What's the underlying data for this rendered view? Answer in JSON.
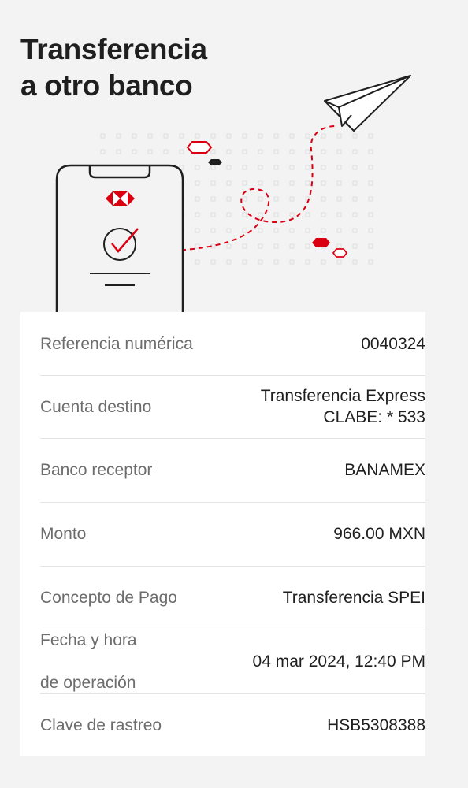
{
  "header": {
    "title_line1": "Transferencia",
    "title_line2": "a otro banco"
  },
  "colors": {
    "accent": "#db0011",
    "text": "#1f1f1f",
    "muted": "#6d6d6d",
    "background": "#f3f3f3"
  },
  "illustration": {
    "icons": [
      "phone-icon",
      "hsbc-logo-icon",
      "check-circle-icon",
      "paper-plane-icon",
      "hexagon-icon"
    ]
  },
  "details": {
    "rows": [
      {
        "label": "Referencia numérica",
        "value": "0040324"
      },
      {
        "label": "Cuenta destino",
        "value_line1": "Transferencia Express",
        "value_line2": "CLABE: * 533"
      },
      {
        "label": "Banco receptor",
        "value": "BANAMEX"
      },
      {
        "label": "Monto",
        "value": "966.00 MXN"
      },
      {
        "label": "Concepto de Pago",
        "value": "Transferencia SPEI"
      },
      {
        "label_line1": "Fecha y hora",
        "label_line2": "de operación",
        "value": "04 mar 2024, 12:40 PM"
      },
      {
        "label": "Clave de rastreo",
        "value": "HSB5308388"
      }
    ]
  }
}
